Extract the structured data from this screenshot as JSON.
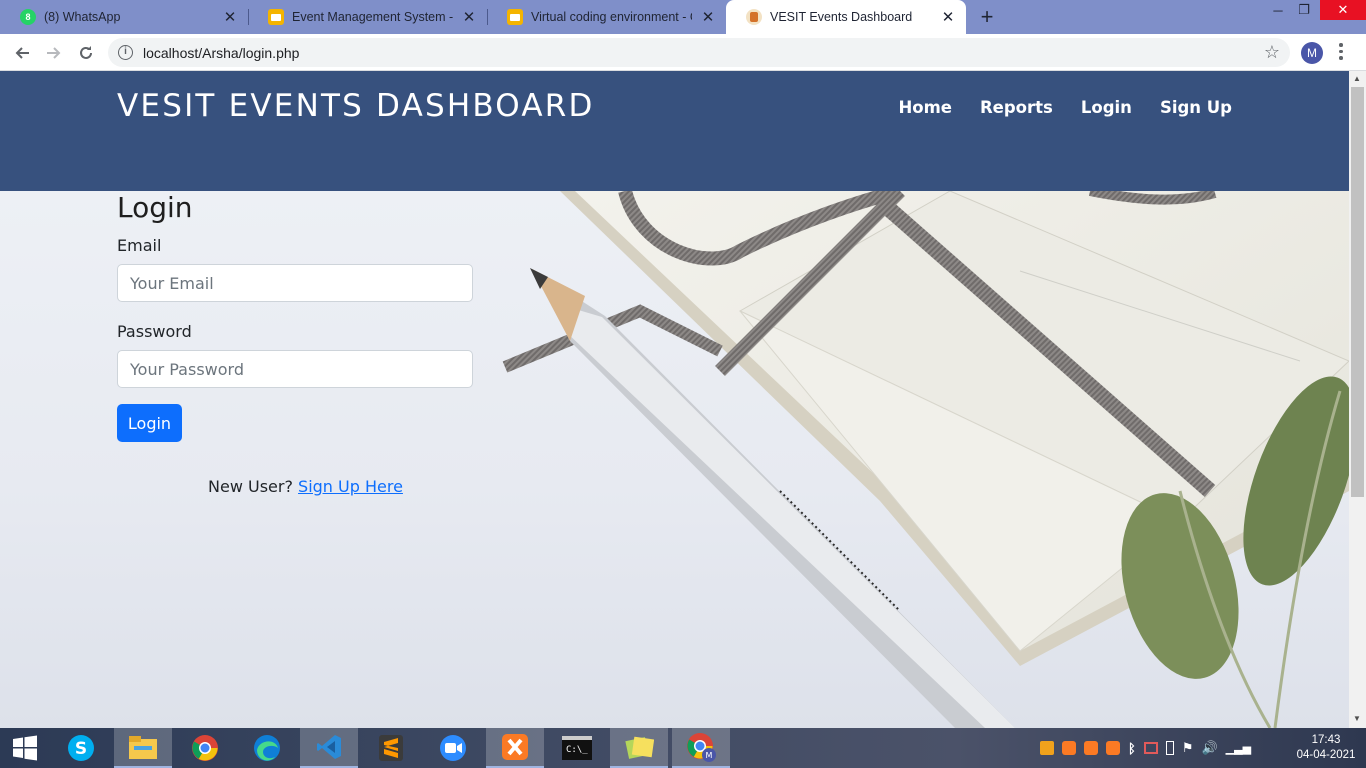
{
  "browser": {
    "tabs": [
      {
        "title": "(8) WhatsApp",
        "icon": "whatsapp-icon"
      },
      {
        "title": "Event Management System - Goo",
        "icon": "google-slides-icon"
      },
      {
        "title": "Virtual coding environment - Goo",
        "icon": "google-slides-icon"
      },
      {
        "title": "VESIT Events Dashboard",
        "icon": "site-favicon"
      }
    ],
    "whatsapp_badge": "8",
    "url": "localhost/Arsha/login.php",
    "profile_initial": "M"
  },
  "site": {
    "brand": "VESIT EVENTS DASHBOARD",
    "nav": [
      "Home",
      "Reports",
      "Login",
      "Sign Up"
    ]
  },
  "login": {
    "title": "Login",
    "email_label": "Email",
    "email_placeholder": "Your Email",
    "password_label": "Password",
    "password_placeholder": "Your Password",
    "button": "Login",
    "new_user_text": "New User?",
    "signup_link": "Sign Up Here"
  },
  "taskbar": {
    "time": "17:43",
    "date": "04-04-2021"
  },
  "colors": {
    "header": "#37517e",
    "primary_button": "#0d6efd",
    "tab_strip": "#7f8fc9"
  }
}
